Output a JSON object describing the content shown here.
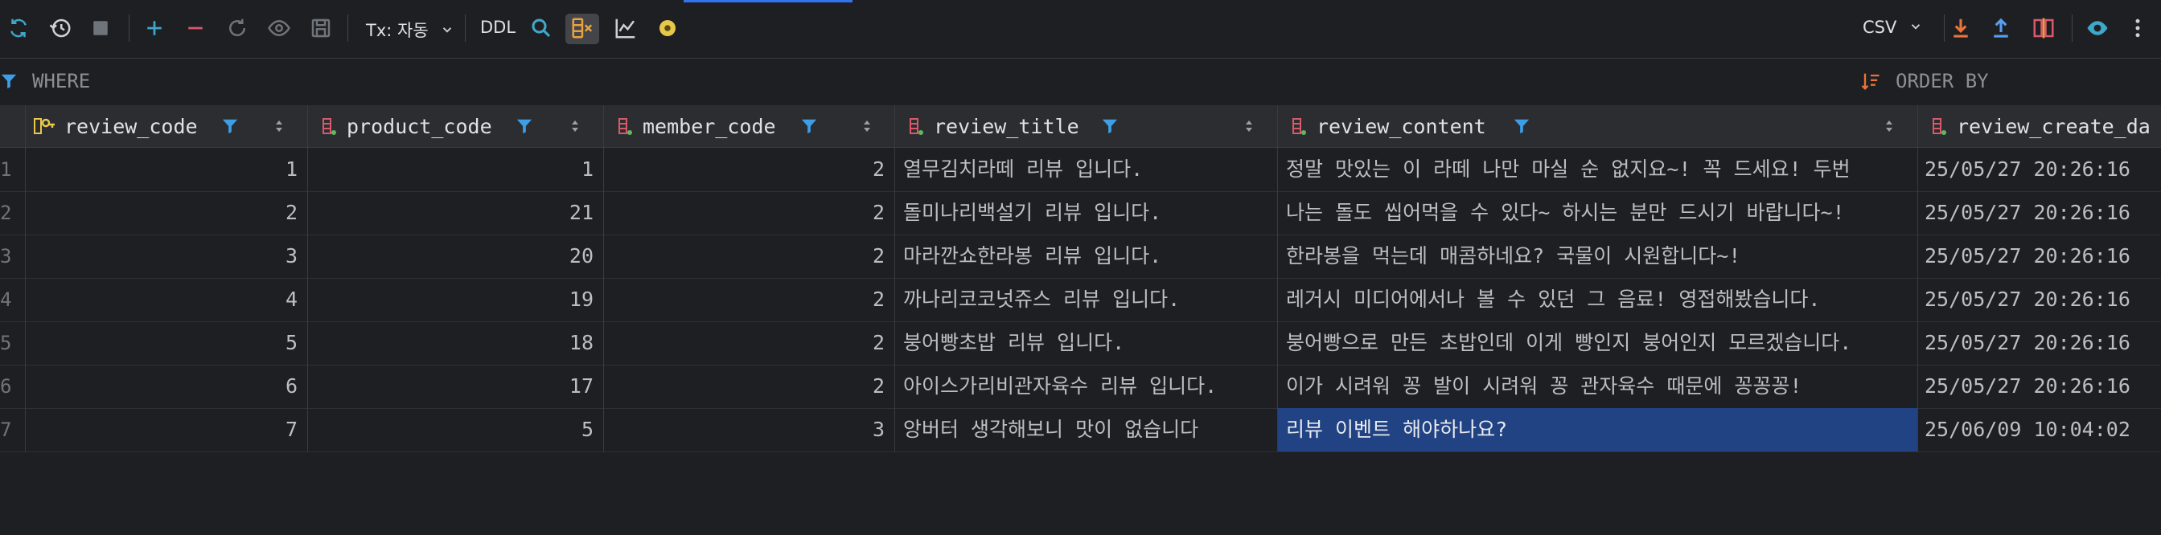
{
  "toolbar": {
    "tx_label": "Tx: 자동",
    "ddl_label": "DDL",
    "export_format": "CSV"
  },
  "filter": {
    "where_label": "WHERE",
    "order_label": "ORDER BY"
  },
  "columns": [
    {
      "name": "review_code",
      "type": "key"
    },
    {
      "name": "product_code",
      "type": "fk"
    },
    {
      "name": "member_code",
      "type": "fk"
    },
    {
      "name": "review_title",
      "type": "fk"
    },
    {
      "name": "review_content",
      "type": "fk"
    },
    {
      "name": "review_create_da",
      "type": "fk"
    }
  ],
  "rows": [
    {
      "n": "1",
      "review_code": "1",
      "product_code": "1",
      "member_code": "2",
      "review_title": "열무김치라떼 리뷰 입니다.",
      "review_content": "정말 맛있는 이 라떼 나만 마실 순 없지요~! 꼭 드세요! 두번",
      "review_create": "25/05/27 20:26:16"
    },
    {
      "n": "2",
      "review_code": "2",
      "product_code": "21",
      "member_code": "2",
      "review_title": "돌미나리백설기 리뷰 입니다.",
      "review_content": "나는 돌도 씹어먹을 수 있다~ 하시는 분만 드시기 바랍니다~!",
      "review_create": "25/05/27 20:26:16"
    },
    {
      "n": "3",
      "review_code": "3",
      "product_code": "20",
      "member_code": "2",
      "review_title": "마라깐쇼한라봉 리뷰 입니다.",
      "review_content": "한라봉을 먹는데 매콤하네요? 국물이 시원합니다~!",
      "review_create": "25/05/27 20:26:16"
    },
    {
      "n": "4",
      "review_code": "4",
      "product_code": "19",
      "member_code": "2",
      "review_title": "까나리코코넛쥬스 리뷰 입니다.",
      "review_content": "레거시 미디어에서나 볼 수 있던 그 음료! 영접해봤습니다.",
      "review_create": "25/05/27 20:26:16"
    },
    {
      "n": "5",
      "review_code": "5",
      "product_code": "18",
      "member_code": "2",
      "review_title": "붕어빵초밥 리뷰 입니다.",
      "review_content": "붕어빵으로 만든 초밥인데 이게 빵인지 붕어인지 모르겠습니다.",
      "review_create": "25/05/27 20:26:16"
    },
    {
      "n": "6",
      "review_code": "6",
      "product_code": "17",
      "member_code": "2",
      "review_title": "아이스가리비관자육수 리뷰 입니다.",
      "review_content": "이가 시려워 꽁 발이 시려워 꽁 관자육수 때문에 꽁꽁꽁!",
      "review_create": "25/05/27 20:26:16"
    },
    {
      "n": "7",
      "review_code": "7",
      "product_code": "5",
      "member_code": "3",
      "review_title": "앙버터 생각해보니 맛이 없습니다",
      "review_content": "리뷰 이벤트 해야하나요?",
      "review_create": "25/06/09 10:04:02"
    }
  ],
  "selected_cell": {
    "row": 7,
    "column": "review_content"
  },
  "colors": {
    "accent": "#3574f0",
    "selection": "#214283",
    "filter_icon": "#3d9ee8",
    "key_icon": "#e8c84a",
    "fk_icon": "#d9596b",
    "export_orange": "#e8743b",
    "import_blue": "#5a9ef0"
  }
}
